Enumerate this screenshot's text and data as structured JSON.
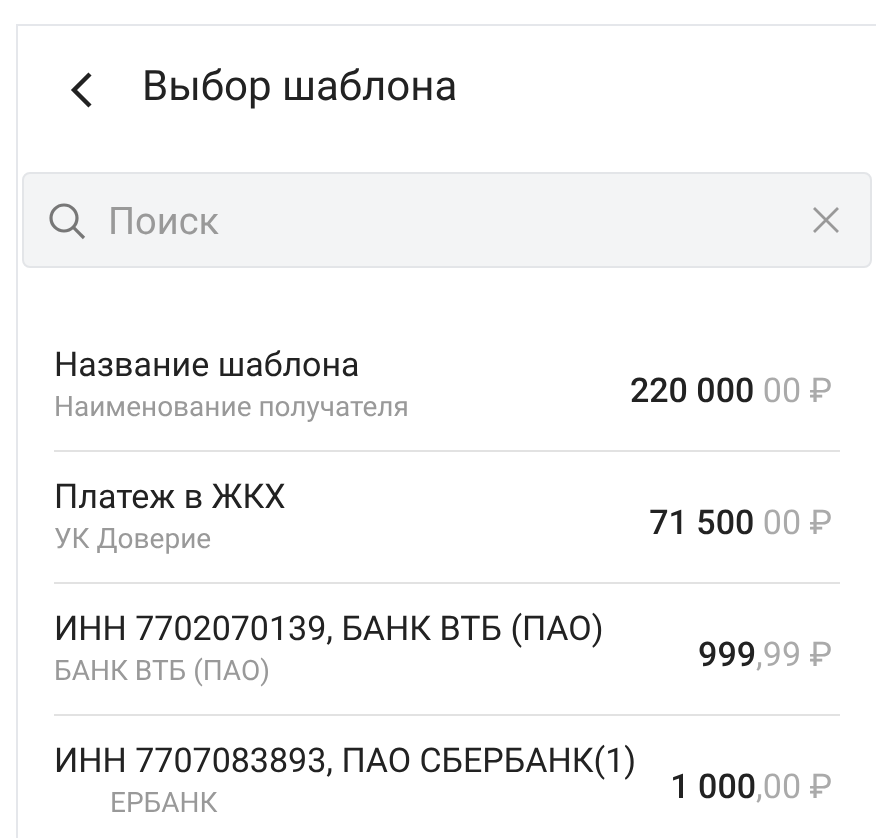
{
  "header": {
    "title": "Выбор шаблона"
  },
  "search": {
    "placeholder": "Поиск"
  },
  "templates": [
    {
      "name": "Название шаблона",
      "recipient": "Наименование получателя",
      "amount_main": "220 000",
      "amount_fraction": " 00",
      "currency": "₽"
    },
    {
      "name": "Платеж в ЖКХ",
      "recipient": "УК Доверие",
      "amount_main": "71 500",
      "amount_fraction": " 00",
      "currency": "₽"
    },
    {
      "name": "ИНН 7702070139, БАНК ВТБ (ПАО)",
      "recipient": "БАНК ВТБ (ПАО)",
      "amount_main": "999",
      "amount_fraction": ",99",
      "currency": "₽"
    },
    {
      "name": "ИНН 7707083893, ПАО СБЕРБАНК(1)",
      "recipient": "ЕРБАНК",
      "amount_main": "1 000",
      "amount_fraction": ",00",
      "currency": "₽"
    }
  ]
}
